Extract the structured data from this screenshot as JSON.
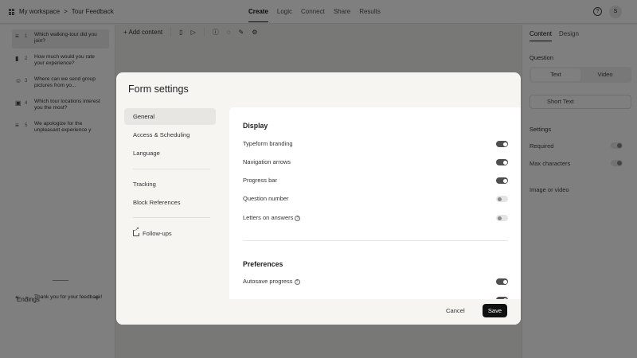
{
  "topbar": {
    "workspace": "My workspace",
    "separator": ">",
    "form_name": "Tour Feedback",
    "tabs": [
      "Create",
      "Logic",
      "Connect",
      "Share",
      "Results"
    ],
    "avatar_initial": "S"
  },
  "toolbar": {
    "add_content": "Add content"
  },
  "left_panel": {
    "questions": [
      {
        "number": "1",
        "text": "Which walking-tour did you join?"
      },
      {
        "number": "2",
        "text": "How much would you rate your experience?"
      },
      {
        "number": "3",
        "text": "Where can we send group pictures from yo..."
      },
      {
        "number": "4",
        "text": "Which tour locations interest you the most?"
      },
      {
        "number": "5",
        "text": "We apologize for the unpleasant experience y"
      }
    ],
    "endings_label": "Endings",
    "ending": {
      "number": "A",
      "text": "Thank you for your feedback!"
    }
  },
  "right_panel": {
    "tabs": [
      "Content",
      "Design"
    ],
    "question_label": "Question",
    "segments": [
      "Text",
      "Video"
    ],
    "type_select": "Short Text",
    "settings_label": "Settings",
    "required": "Required",
    "max_characters": "Max characters",
    "image_or_video": "Image or video"
  },
  "modal": {
    "title": "Form settings",
    "nav": [
      "General",
      "Access & Scheduling",
      "Language",
      "Tracking",
      "Block References",
      "Follow-ups"
    ],
    "active_nav": "General",
    "display": {
      "heading": "Display",
      "settings": [
        {
          "label": "Typeform branding",
          "enabled": true
        },
        {
          "label": "Navigation arrows",
          "enabled": true
        },
        {
          "label": "Progress bar",
          "enabled": true
        },
        {
          "label": "Question number",
          "enabled": false
        },
        {
          "label": "Letters on answers",
          "enabled": false
        }
      ]
    },
    "preferences": {
      "heading": "Preferences",
      "settings": [
        {
          "label": "Autosave progress",
          "enabled": true
        }
      ]
    },
    "cancel_label": "Cancel",
    "save_label": "Save"
  },
  "colors": {
    "overlay": "#000000",
    "toggle_on": "#4f4f4f",
    "save_button": "#111111"
  }
}
